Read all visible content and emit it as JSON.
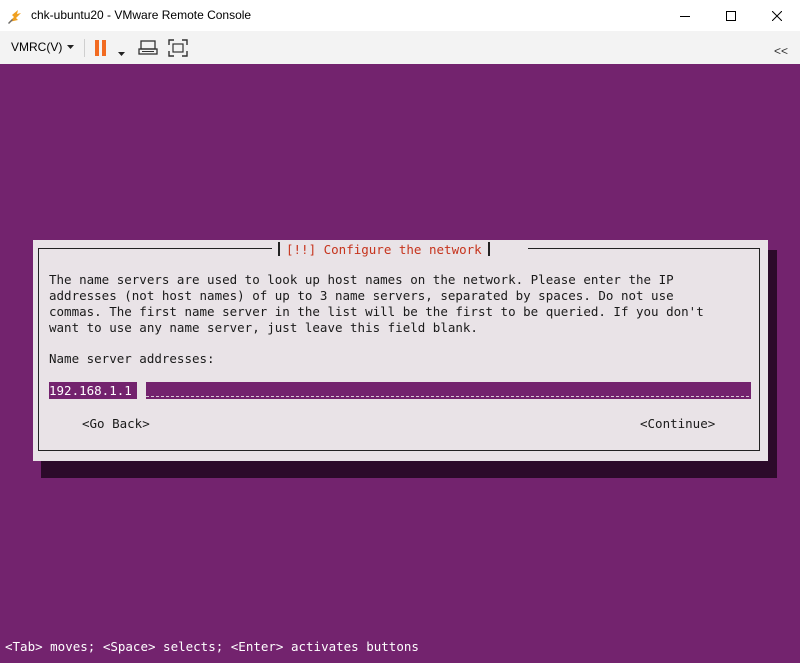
{
  "window": {
    "title": "chk-ubuntu20 - VMware Remote Console",
    "app_icon": "vmware-remote-console-icon",
    "controls": [
      "minimize-icon",
      "maximize-icon",
      "close-icon"
    ]
  },
  "toolbar": {
    "menu_label": "VMRC(V)",
    "icons": [
      "pause-icon",
      "send-ctrl-alt-del-icon",
      "fullscreen-icon",
      "collapse-toolbar-icon"
    ],
    "collapse_glyph": "<<",
    "pause_color": "#f26b21"
  },
  "console": {
    "background": "#73236e",
    "dialog": {
      "title": "[!!] Configure the network",
      "body": "The name servers are used to look up host names on the network. Please enter the IP\naddresses (not host names) of up to 3 name servers, separated by spaces. Do not use\ncommas. The first name server in the list will be the first to be queried. If you don't\nwant to use any name server, just leave this field blank.",
      "field_label": "Name server addresses:",
      "field_value": "192.168.1.1",
      "back_button": "<Go Back>",
      "continue_button": "<Continue>"
    },
    "hint": "<Tab> moves; <Space> selects; <Enter> activates buttons"
  }
}
